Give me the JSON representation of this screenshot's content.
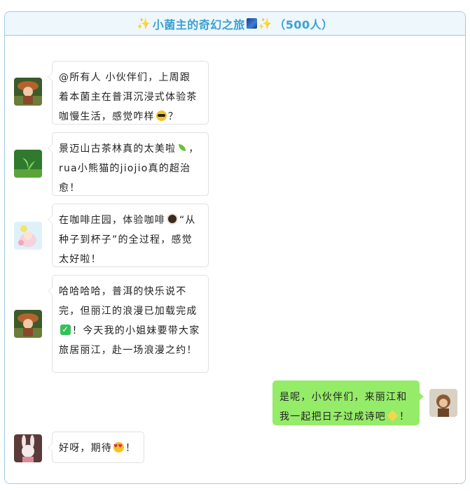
{
  "header": {
    "prefix_emoji": "✨",
    "title": "小菌主的奇幻之旅",
    "suffix_emoji": "✨",
    "member_count": "（500人）"
  },
  "messages": [
    {
      "side": "left",
      "avatar": "mushroom-host-avatar",
      "text_parts": [
        "@所有人 小伙伴们，上周跟着本菌主在普洱沉浸式体验茶咖慢生活，感觉咋样",
        "？"
      ],
      "emoji": "sunglasses-emoji"
    },
    {
      "side": "left",
      "avatar": "sprout-avatar",
      "text_parts": [
        "景迈山古茶林真的太美啦",
        "，rua小熊猫的jiojio真的超治愈！"
      ],
      "emoji": "herb-emoji"
    },
    {
      "side": "left",
      "avatar": "flower-fairy-avatar",
      "text_parts": [
        "在咖啡庄园，体验咖啡",
        "“从种子到杯子”的全过程，感觉太好啦！"
      ],
      "emoji": "coffee-emoji"
    },
    {
      "side": "left",
      "avatar": "mushroom-host-avatar",
      "text_parts": [
        "哈哈哈哈，普洱的快乐说不完，但丽江的浪漫已加载完成",
        "！今天我的小姐妹要带大家旅居丽江，赴一场浪漫之约！"
      ],
      "emoji": "check-mark-emoji"
    },
    {
      "side": "right",
      "avatar": "monkey-avatar",
      "text_parts": [
        "是呢，小伙伴们，来丽江和我一起把日子过成诗吧",
        "！"
      ],
      "emoji": "sparkle-emoji"
    },
    {
      "side": "left",
      "avatar": "bunny-avatar",
      "text_parts": [
        "好呀，期待",
        "！"
      ],
      "emoji": "heart-eyes-emoji"
    }
  ]
}
